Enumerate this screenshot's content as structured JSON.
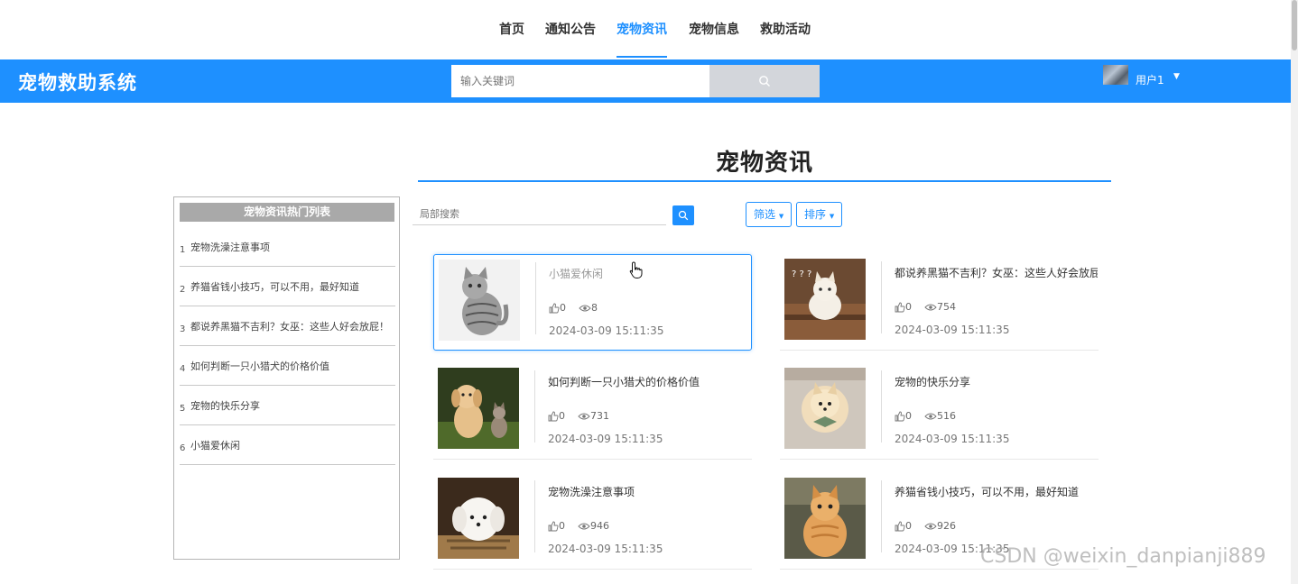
{
  "nav": {
    "items": [
      {
        "label": "首页",
        "active": false
      },
      {
        "label": "通知公告",
        "active": false
      },
      {
        "label": "宠物资讯",
        "active": true
      },
      {
        "label": "宠物信息",
        "active": false
      },
      {
        "label": "救助活动",
        "active": false
      }
    ],
    "active_color": "#1e90ff"
  },
  "header": {
    "brand": "宠物救助系统",
    "search_placeholder": "输入关键词",
    "username": "用户1",
    "bar_color": "#1e90ff"
  },
  "page": {
    "title": "宠物资讯"
  },
  "hot_list": {
    "title": "宠物资讯热门列表",
    "items": [
      {
        "num": "1",
        "text": "宠物洗澡注意事项"
      },
      {
        "num": "2",
        "text": "养猫省钱小技巧，可以不用，最好知道"
      },
      {
        "num": "3",
        "text": "都说养黑猫不吉利？女巫：这些人好会放屁！"
      },
      {
        "num": "4",
        "text": "如何判断一只小猎犬的价格价值"
      },
      {
        "num": "5",
        "text": "宠物的快乐分享"
      },
      {
        "num": "6",
        "text": "小猫爱休闲"
      }
    ]
  },
  "filters": {
    "local_search_placeholder": "局部搜索",
    "filter_label": "筛选",
    "sort_label": "排序"
  },
  "articles": [
    {
      "title": "小猫爱休闲",
      "likes": "0",
      "views": "8",
      "time": "2024-03-09 15:11:35",
      "image": "tabby-cat-photo",
      "hovered": true
    },
    {
      "title": "都说养黑猫不吉利？女巫：这些人好会放屁",
      "likes": "0",
      "views": "754",
      "time": "2024-03-09 15:11:35",
      "image": "cat-on-stairs-photo",
      "hovered": false
    },
    {
      "title": "如何判断一只小猎犬的价格价值",
      "likes": "0",
      "views": "731",
      "time": "2024-03-09 15:11:35",
      "image": "puppy-and-kitten-photo",
      "hovered": false
    },
    {
      "title": "宠物的快乐分享",
      "likes": "0",
      "views": "516",
      "time": "2024-03-09 15:11:35",
      "image": "pomeranian-photo",
      "hovered": false
    },
    {
      "title": "宠物洗澡注意事项",
      "likes": "0",
      "views": "946",
      "time": "2024-03-09 15:11:35",
      "image": "white-puppy-photo",
      "hovered": false
    },
    {
      "title": "养猫省钱小技巧，可以不用，最好知道",
      "likes": "0",
      "views": "926",
      "time": "2024-03-09 15:11:35",
      "image": "orange-cat-photo",
      "hovered": false
    }
  ],
  "watermark": "CSDN @weixin_danpianji889"
}
